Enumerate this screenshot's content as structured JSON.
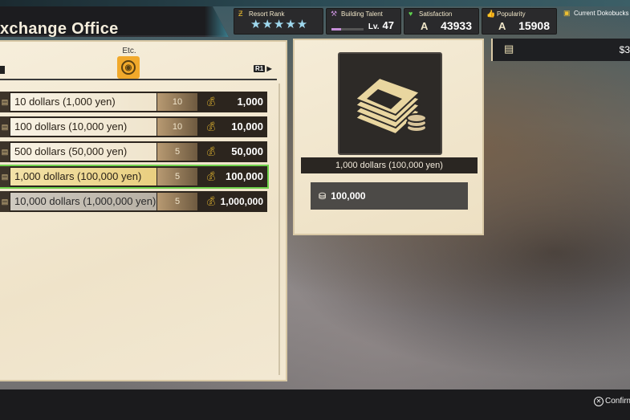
{
  "header": {
    "title": "xchange Office"
  },
  "status": {
    "resort_rank": {
      "label": "Resort Rank",
      "stars": "★★★★★",
      "rating": 5
    },
    "building_talent": {
      "label": "Building Talent",
      "level_prefix": "Lv.",
      "level": "47"
    },
    "satisfaction": {
      "label": "Satisfaction",
      "grade": "A",
      "value": "43933"
    },
    "popularity": {
      "label": "Popularity",
      "grade": "A",
      "value": "15908"
    },
    "dokobucks": {
      "label": "Current Dokobucks",
      "amount": "$3"
    }
  },
  "tabs": {
    "etc_label": "Etc.",
    "next_hint": "R1"
  },
  "items": [
    {
      "name": "10 dollars (1,000 yen)",
      "qty": "10",
      "price": "1,000"
    },
    {
      "name": "100 dollars (10,000 yen)",
      "qty": "10",
      "price": "10,000"
    },
    {
      "name": "500 dollars (50,000 yen)",
      "qty": "5",
      "price": "50,000"
    },
    {
      "name": "1,000 dollars (100,000 yen)",
      "qty": "5",
      "price": "100,000"
    },
    {
      "name": "10,000 dollars (1,000,000 yen)",
      "qty": "5",
      "price": "1,000,000"
    }
  ],
  "detail": {
    "name": "1,000 dollars (100,000 yen)",
    "price": "100,000"
  },
  "footer": {
    "confirm_label": "Confirm"
  },
  "colors": {
    "selection_outline": "#6ed14a",
    "accent_gold": "#f1a92b"
  }
}
